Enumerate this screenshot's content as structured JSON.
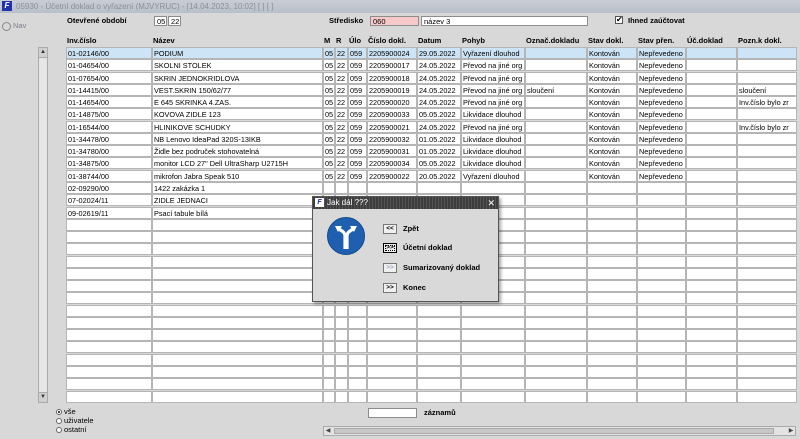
{
  "window": {
    "title": "05930 - Účetní doklad o vyřazení (MJVYRUC) - [14.04.2023, 10:02] [ ] [ ]",
    "nav_label": "Nav"
  },
  "filters": {
    "period_label": "Otevřené období",
    "period_year": "05",
    "period_month": "22",
    "center_label": "Středisko",
    "center_code": "060",
    "center_name": "název 3",
    "auto_post_label": "Ihned zaúčtovat",
    "auto_post_checked": true
  },
  "columns": [
    "Inv.číslo",
    "Název",
    "M",
    "R",
    "Úlo",
    "Číslo dokl.",
    "Datum",
    "Pohyb",
    "Označ.dokladu",
    "Stav dokl.",
    "Stav přen.",
    "Úč.doklad",
    "Pozn.k dokl."
  ],
  "rows": [
    [
      "01-02146/00",
      "PODIUM",
      "05",
      "22",
      "059",
      "2205900024",
      "29.05.2022",
      "Vyřazení dlouhod",
      "",
      "Kontován",
      "Nepřevedeno",
      "",
      ""
    ],
    [
      "01-04654/00",
      "SKOLNI STOLEK",
      "05",
      "22",
      "059",
      "2205900017",
      "24.05.2022",
      "Převod na jiné org",
      "",
      "Kontován",
      "Nepřevedeno",
      "",
      ""
    ],
    [
      "01-07654/00",
      "SKRIN JEDNOKRIDLOVA",
      "05",
      "22",
      "059",
      "2205900018",
      "24.05.2022",
      "Převod na jiné org",
      "",
      "Kontován",
      "Nepřevedeno",
      "",
      ""
    ],
    [
      "01-14415/00",
      "VEST.SKRIN 150/62/77",
      "05",
      "22",
      "059",
      "2205900019",
      "24.05.2022",
      "Převod na jiné org",
      "sloučení",
      "Kontován",
      "Nepřevedeno",
      "",
      "sloučení"
    ],
    [
      "01-14654/00",
      "E 645 SKRINKA 4.ZAS.",
      "05",
      "22",
      "059",
      "2205900020",
      "24.05.2022",
      "Převod na jiné org",
      "",
      "Kontován",
      "Nepřevedeno",
      "",
      "Inv.číslo bylo zr"
    ],
    [
      "01-14875/00",
      "KOVOVA ZIDLE 123",
      "05",
      "22",
      "059",
      "2205900033",
      "05.05.2022",
      "Likvidace dlouhod",
      "",
      "Kontován",
      "Nepřevedeno",
      "",
      ""
    ],
    [
      "01-16544/00",
      "HLINIKOVE SCHUDKY",
      "05",
      "22",
      "059",
      "2205900021",
      "24.05.2022",
      "Převod na jiné org",
      "",
      "Kontován",
      "Nepřevedeno",
      "",
      "Inv.číslo bylo zr"
    ],
    [
      "01-34478/00",
      "NB Lenovo IdeaPad 320S-13IKB",
      "05",
      "22",
      "059",
      "2205900032",
      "01.05.2022",
      "Likvidace dlouhod",
      "",
      "Kontován",
      "Nepřevedeno",
      "",
      ""
    ],
    [
      "01-34780/00",
      "Židle bez područek stohovatelná",
      "05",
      "22",
      "059",
      "2205900031",
      "01.05.2022",
      "Likvidace dlouhod",
      "",
      "Kontován",
      "Nepřevedeno",
      "",
      ""
    ],
    [
      "01-34875/00",
      "monitor LCD 27\" Dell UltraSharp U2715H",
      "05",
      "22",
      "059",
      "2205900034",
      "05.05.2022",
      "Likvidace dlouhod",
      "",
      "Kontován",
      "Nepřevedeno",
      "",
      ""
    ],
    [
      "01-38744/00",
      "mikrofon Jabra Speak 510",
      "05",
      "22",
      "059",
      "2205900022",
      "20.05.2022",
      "Vyřazení dlouhod",
      "",
      "Kontován",
      "Nepřevedeno",
      "",
      ""
    ],
    [
      "02-09290/00",
      "1422 zakázka 1",
      "",
      "",
      "",
      "",
      "",
      "",
      "",
      "",
      "",
      "",
      ""
    ],
    [
      "07-02024/11",
      "ZIDLE JEDNACI",
      "",
      "",
      "",
      "",
      "",
      "",
      "",
      "",
      "",
      "",
      ""
    ],
    [
      "09-02619/11",
      "Psací tabule bílá",
      "",
      "",
      "",
      "",
      "",
      "",
      "",
      "",
      "",
      "",
      ""
    ]
  ],
  "footer": {
    "records_label": "záznamů",
    "records_value": "",
    "radio_options": [
      "vše",
      "uživatele",
      "ostatní"
    ],
    "radio_selected": 0
  },
  "dialog": {
    "title": "Jak dál ???",
    "sign_icon": "turn-left-or-right-sign-icon",
    "buttons": [
      {
        "glyph": "<<",
        "label": "Zpět",
        "state": "normal"
      },
      {
        "glyph": ">>",
        "label": "Účetní doklad",
        "state": "focused"
      },
      {
        "glyph": ">>",
        "label": "Sumarizovaný doklad",
        "state": "disabled"
      },
      {
        "glyph": ">>",
        "label": "Konec",
        "state": "normal"
      }
    ]
  },
  "colors": {
    "selected_row": "#cde4f7",
    "center_code_bg": "#f6c8c8",
    "sign_blue": "#1f5fb0"
  }
}
